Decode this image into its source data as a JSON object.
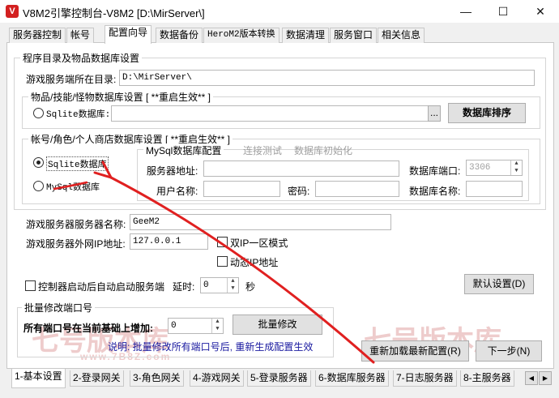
{
  "window": {
    "title": "V8M2引擎控制台-V8M2 [D:\\MirServer\\]",
    "app_icon_letter": "V",
    "minimize": "—",
    "maximize": "☐",
    "close": "✕"
  },
  "top_tabs": [
    "服务器控制",
    "帐号",
    "配置向导",
    "数据备份",
    "HeroM2版本转换",
    "数据清理",
    "服务窗口",
    "相关信息"
  ],
  "group_program_dir": {
    "title": "程序目录及物品数据库设置",
    "server_dir_label": "游戏服务端所在目录:",
    "server_dir_value": "D:\\MirServer\\"
  },
  "group_items_db": {
    "title": "物品/技能/怪物数据库设置 [ **重启生效** ]",
    "sqlite_label": "Sqlite数据库:",
    "sqlite_value": "",
    "browse_label": "...",
    "sort_button": "数据库排序"
  },
  "group_account_db": {
    "title": "帐号/角色/个人商店数据库设置 [ **重启生效** ]",
    "sqlite_radio": "Sqlite数据库",
    "mysql_radio": "MySql数据库",
    "mysql_config_title": "MySql数据库配置",
    "test_connection": "连接测试",
    "init_db": "数据库初始化",
    "server_addr_label": "服务器地址:",
    "server_addr_value": "",
    "port_label": "数据库端口:",
    "port_value": "3306",
    "user_label": "用户名称:",
    "user_value": "",
    "password_label": "密码:",
    "password_value": "",
    "dbname_label": "数据库名称:",
    "dbname_value": ""
  },
  "server_settings": {
    "name_label": "游戏服务器服务器名称:",
    "name_value": "GeeM2",
    "ip_label": "游戏服务器外网IP地址:",
    "ip_value": "127.0.0.1",
    "dual_ip_label": "双IP一区模式",
    "dynamic_ip_label": "动态IP地址",
    "autostart_label": "控制器启动后自动启动服务端",
    "delay_label": "延时:",
    "delay_value": "0",
    "delay_unit": "秒",
    "default_button": "默认设置(D)"
  },
  "batch_ports": {
    "title": "批量修改端口号",
    "increase_label": "所有端口号在当前基础上增加:",
    "increase_value": "0",
    "modify_button": "批量修改",
    "note": "说明: 批量修改所有端口号后, 重新生成配置生效"
  },
  "actions": {
    "reload_button": "重新加载最新配置(R)",
    "next_button": "下一步(N)"
  },
  "watermark": {
    "text_left": "七号版本库",
    "text_right": "七号版本库",
    "url": "www.7B8Z.com"
  },
  "bottom_tabs": [
    "1-基本设置",
    "2-登录网关",
    "3-角色网关",
    "4-游戏网关",
    "5-登录服务器",
    "6-数据库服务器",
    "7-日志服务器",
    "8-主服务器"
  ],
  "scroll_left": "◀",
  "scroll_right": "▶",
  "colors": {
    "annotation_arrow": "#e02020",
    "note_text": "#1a1aa0",
    "disabled_text": "#a0a0a0"
  }
}
